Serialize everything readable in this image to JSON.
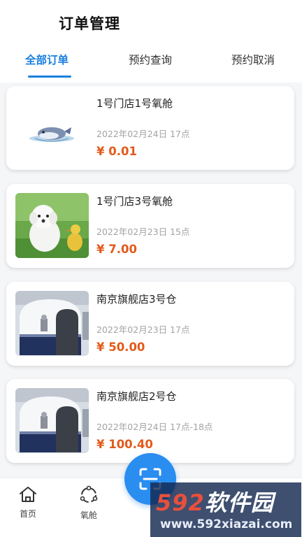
{
  "header": {
    "title": "订单管理"
  },
  "tabs": [
    {
      "label": "全部订单",
      "active": true
    },
    {
      "label": "预约查询",
      "active": false
    },
    {
      "label": "预约取消",
      "active": false
    }
  ],
  "orders": [
    {
      "title": "1号门店1号氧舱",
      "date": "2022年02月24日 17点",
      "price": "¥ 0.01",
      "image": "toy-fish-picture"
    },
    {
      "title": "1号门店3号氧舱",
      "date": "2022年02月23日 15点",
      "price": "¥ 7.00",
      "image": "puppy-and-duckling-photo"
    },
    {
      "title": "南京旗舰店3号仓",
      "date": "2022年02月23日 17点",
      "price": "¥ 50.00",
      "image": "oxygen-chamber-photo"
    },
    {
      "title": "南京旗舰店2号仓",
      "date": "2022年02月24日 17点-18点",
      "price": "¥ 100.40",
      "image": "oxygen-chamber-photo"
    }
  ],
  "tabbar": {
    "items": [
      {
        "label": "首页",
        "icon": "home-icon"
      },
      {
        "label": "氧舱",
        "icon": "cabin-icon"
      }
    ],
    "fab_icon": "scan-icon"
  },
  "watermark": {
    "brand_digits": "592",
    "brand_text": "软件园",
    "url": "www.592xiazai.com"
  },
  "colors": {
    "accent": "#1a7fe0",
    "price": "#e25a1b",
    "fab": "#2a8df0"
  }
}
